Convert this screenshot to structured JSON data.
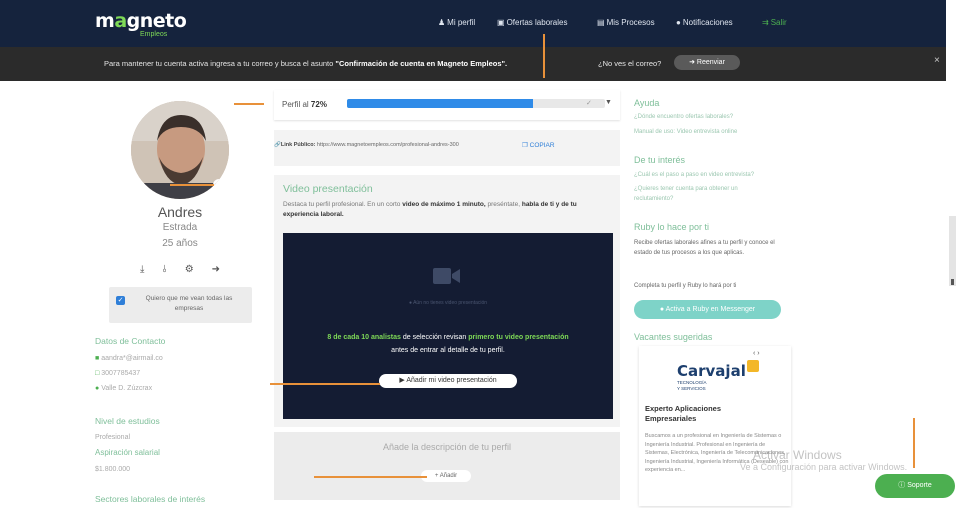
{
  "nav": {
    "logo_main_prefix": "m",
    "logo_main_accent": "a",
    "logo_main_rest": "gneto",
    "logo_sub": "Empleos",
    "items": [
      {
        "label": "Mi perfil",
        "icon": "user-icon"
      },
      {
        "label": "Ofertas laborales",
        "icon": "briefcase-icon"
      },
      {
        "label": "Mis Procesos",
        "icon": "list-icon"
      },
      {
        "label": "Notificaciones",
        "icon": "bell-icon"
      },
      {
        "label": "Salir",
        "icon": "logout-icon"
      }
    ]
  },
  "banner": {
    "text_before": "Para mantener tu cuenta activa ingresa a tu correo y busca el asunto",
    "text_bold": "\"Confirmación de cuenta en Magneto Empleos\".",
    "question": "¿No ves el correo?",
    "button": "Reenviar",
    "close": "×"
  },
  "profile": {
    "name": "Andres",
    "city": "Estrada",
    "age": "25 años",
    "consent_label": "Quiero que me vean todas las empresas",
    "contact_title": "Datos de Contacto",
    "email": "aandra*@airmail.co",
    "phone": "3007785437",
    "location": "Valle D. Zúzcrax",
    "education_title": "Nivel de estudios",
    "education_value": "Profesional",
    "salary_title": "Aspiración salarial",
    "salary_value": "$1.800.000",
    "sectors_title": "Sectores laborales de interés"
  },
  "progress": {
    "label": "Perfil al",
    "percent_text": "72%",
    "value": 0.72
  },
  "public_url": {
    "label": "Link Público:",
    "url": "https://www.magnetoempleos.com/profesional-andres-300",
    "copy": "COPIAR"
  },
  "video": {
    "title": "Video presentación",
    "desc_start": "Destaca tu perfil profesional. En un corto",
    "desc_bold": "video de máximo 1 minuto,",
    "desc_mid": "preséntate,",
    "desc_bold2": "habla de ti y de tu experiencia laboral.",
    "placeholder": "Aún no tienes video presentación",
    "msg_start": "8 de cada 10 analistas",
    "msg_mid": "de selección revisan",
    "msg_bold": "primero tu video presentación",
    "msg_end": "antes de entrar al detalle de tu perfil.",
    "button": "Añadir mi video presentación"
  },
  "description": {
    "title": "Añade la descripción de tu perfil",
    "button": "+ Añadir"
  },
  "sidebar_right": {
    "help_title": "Ayuda",
    "help_links": [
      "¿Dónde encuentro ofertas laborales?",
      "Manual de uso: Video entrevista online"
    ],
    "interest_title": "De tu interés",
    "interest_links": [
      "¿Cuál es el paso a paso en video entrevista?",
      "¿Quieres tener cuenta para obtener un",
      "reclutamiento?"
    ],
    "ruby_title": "Ruby lo hace por ti",
    "ruby_text": "Recibe ofertas laborales afines a tu perfil y conoce el estado de tus procesos a los que aplicas.",
    "ruby_text2": "Completa tu perfil y Ruby lo hará por ti",
    "ruby_button": "Activa a Ruby en Messenger",
    "suggested_title": "Vacantes sugeridas"
  },
  "job": {
    "nav": "‹ ›",
    "company": "Carvajal",
    "company_sub_1": "TECNOLOGÍA",
    "company_sub_2": "Y SERVICIOS",
    "title_1": "Experto Aplicaciones",
    "title_2": "Empresariales",
    "description": "Buscamos a un profesional en Ingeniería de Sistemas o Ingeniería Industrial. Profesional en Ingeniería de Sistemas, Electrónica, Ingeniería de Telecomunicaciones, Ingeniería Industrial, Ingeniería Informática (Deseable) con experiencia en..."
  },
  "watermark": {
    "line1": "Activar Windows",
    "line2": "Ve a Configuración para activar Windows."
  },
  "support": {
    "label": "Soporte"
  },
  "colors": {
    "nav_bg": "#15233d",
    "accent_green": "#7ed957",
    "progress_blue": "#2f8be8",
    "annotation_orange": "#e8913a"
  }
}
